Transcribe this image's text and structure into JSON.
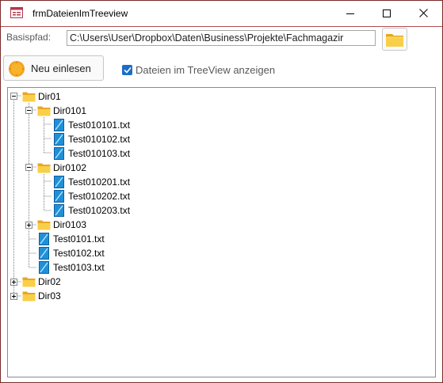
{
  "window": {
    "title": "frmDateienImTreeview"
  },
  "form": {
    "basis_label": "Basispfad:",
    "basis_value": "C:\\Users\\User\\Dropbox\\Daten\\Business\\Projekte\\Fachmagazir",
    "reload_label": "Neu einlesen",
    "show_files_label": "Dateien im TreeView anzeigen",
    "show_files_checked": true
  },
  "tree": {
    "dir01": "Dir01",
    "dir0101": "Dir0101",
    "f010101": "Test010101.txt",
    "f010102": "Test010102.txt",
    "f010103": "Test010103.txt",
    "dir0102": "Dir0102",
    "f010201": "Test010201.txt",
    "f010202": "Test010202.txt",
    "f010203": "Test010203.txt",
    "dir0103": "Dir0103",
    "f0101": "Test0101.txt",
    "f0102": "Test0102.txt",
    "f0103": "Test0103.txt",
    "dir02": "Dir02",
    "dir03": "Dir03"
  },
  "colors": {
    "accent": "#1c6dc9",
    "folder": "#f7c948",
    "file": "#1e90d8",
    "title_border": "#b34a4a"
  }
}
